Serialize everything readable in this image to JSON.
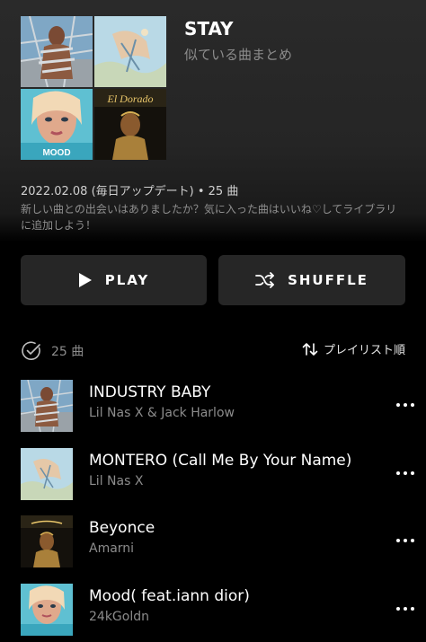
{
  "playlist": {
    "title": "STAY",
    "subtitle": "似ている曲まとめ",
    "meta": "2022.02.08 (毎日アップデート) • 25 曲",
    "description": "新しい曲との出会いはありましたか？気に入った曲はいいね♡してライブラリに追加しよう！"
  },
  "actions": {
    "play_label": "PLAY",
    "shuffle_label": "SHUFFLE"
  },
  "list": {
    "count_label": "25 曲",
    "sort_label": "プレイリスト順"
  },
  "tracks": [
    {
      "title": "INDUSTRY BABY",
      "artist": "Lil Nas X & Jack Harlow"
    },
    {
      "title": "MONTERO (Call Me By Your Name)",
      "artist": "Lil Nas X"
    },
    {
      "title": "Beyonce",
      "artist": "Amarni"
    },
    {
      "title": "Mood( feat.iann dior)",
      "artist": "24kGoldn"
    }
  ],
  "colors": {
    "background": "#000000",
    "header_bg": "#252525",
    "button_bg": "#262626",
    "secondary_text": "#8c8c8c"
  },
  "icons": {
    "play": "play-icon",
    "shuffle": "shuffle-icon",
    "check": "check-circle-icon",
    "sort": "sort-arrows-icon",
    "more": "more-horizontal-icon"
  },
  "artwork": {
    "cover_el_dorado_text": "El Dorado",
    "cover_mood_text": "MOOD"
  }
}
